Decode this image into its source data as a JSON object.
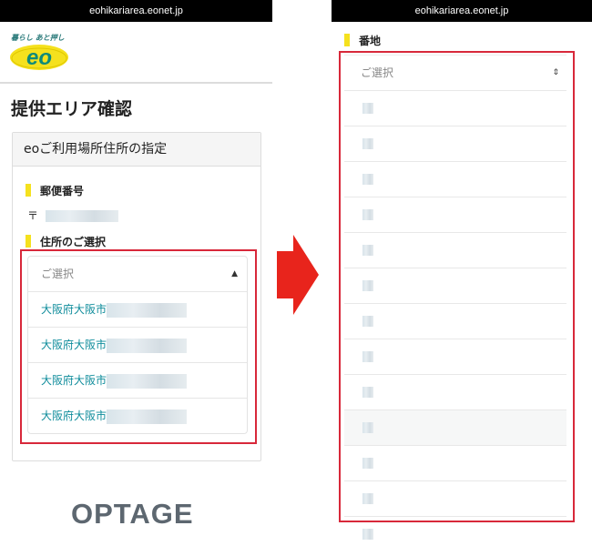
{
  "left_screen": {
    "url": "eohikariarea.eonet.jp",
    "tagline": "暮らし あと押し",
    "logo_text": "eo",
    "page_title": "提供エリア確認",
    "card_header": "eoご利用場所住所の指定",
    "postal_label": "郵便番号",
    "postal_prefix": "〒",
    "address_label": "住所のご選択",
    "select_placeholder": "ご選択",
    "options": [
      "大阪府大阪市",
      "大阪府大阪市",
      "大阪府大阪市",
      "大阪府大阪市"
    ],
    "footer_logo": "OPTAGE"
  },
  "right_screen": {
    "url": "eohikariarea.eonet.jp",
    "label": "番地",
    "select_placeholder": "ご選択"
  },
  "colors": {
    "accent_yellow": "#f5e11e",
    "link_teal": "#0e8c9b",
    "highlight_red": "#d8283a",
    "arrow_red": "#e8241c"
  },
  "icons": {
    "select": "sort-icon",
    "transition": "arrow-right-icon"
  }
}
